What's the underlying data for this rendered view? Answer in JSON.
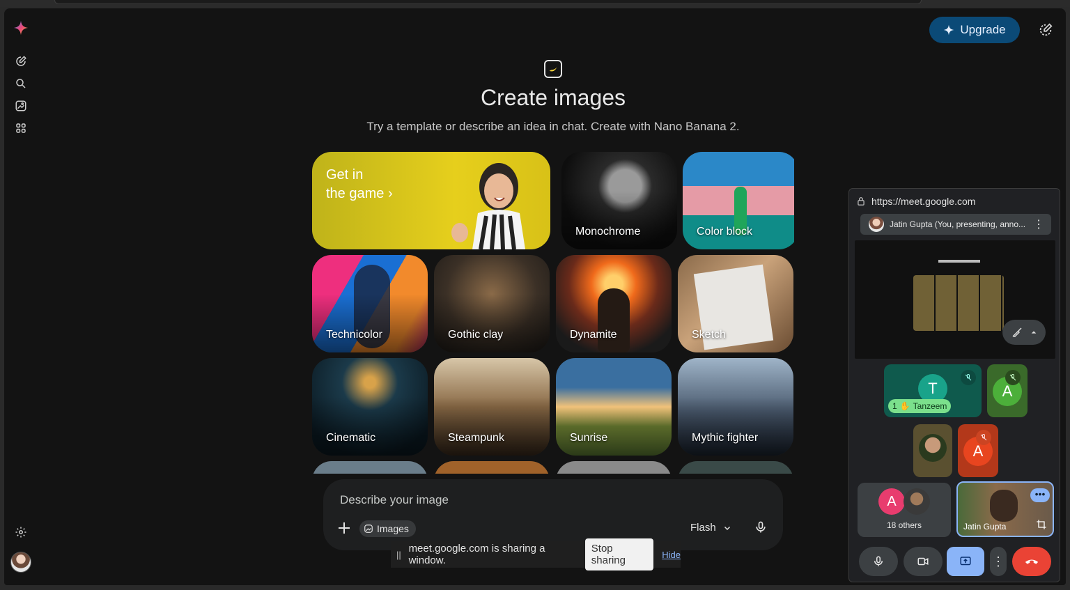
{
  "header": {
    "upgrade_label": "Upgrade"
  },
  "hero": {
    "title": "Create images",
    "subtitle": "Try a template or describe an idea in chat. Create with Nano Banana 2."
  },
  "templates": [
    {
      "label_line1": "Get in",
      "label_line2": "the game",
      "chevron": "›"
    },
    {
      "label": "Monochrome"
    },
    {
      "label": "Color block"
    },
    {
      "label": "Technicolor"
    },
    {
      "label": "Gothic clay"
    },
    {
      "label": "Dynamite"
    },
    {
      "label": "Sketch"
    },
    {
      "label": "Cinematic"
    },
    {
      "label": "Steampunk"
    },
    {
      "label": "Sunrise"
    },
    {
      "label": "Mythic fighter"
    }
  ],
  "composer": {
    "placeholder": "Describe your image",
    "chip_label": "Images",
    "model_label": "Flash"
  },
  "share_bar": {
    "message": "meet.google.com is sharing a window.",
    "stop_label": "Stop sharing",
    "hide_label": "Hide"
  },
  "meet": {
    "url": "https://meet.google.com",
    "presenter_label": "Jatin Gupta (You, presenting, anno...",
    "participants": [
      {
        "initial": "T",
        "name": "Tanzeem",
        "hand_label": "1"
      },
      {
        "initial": "A"
      },
      {
        "initial": "A"
      }
    ],
    "others_initial": "A",
    "others_label": "18 others",
    "self_name": "Jatin Gupta"
  },
  "colors": {
    "background": "#131313",
    "upgrade_bg": "#0b4a77",
    "end_call": "#ea4335",
    "present_active": "#8ab4f8",
    "tanzeem_tile": "#0f5a4d",
    "a_green": "#3f8f3a",
    "a_red": "#e8451f",
    "a_pink": "#e83c6e"
  }
}
